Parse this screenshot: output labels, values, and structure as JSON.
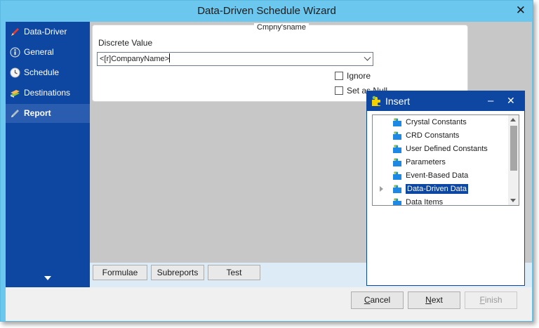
{
  "window": {
    "title": "Data-Driven Schedule Wizard"
  },
  "sidebar": {
    "items": [
      {
        "label": "Data-Driver",
        "icon": "pen-icon",
        "active": false
      },
      {
        "label": "General",
        "icon": "info-icon",
        "active": false
      },
      {
        "label": "Schedule",
        "icon": "clock-icon",
        "active": false
      },
      {
        "label": "Destinations",
        "icon": "books-icon",
        "active": false
      },
      {
        "label": "Report",
        "icon": "pencil-icon",
        "active": true
      }
    ]
  },
  "parameter": {
    "group_title": "Cmpny'sname",
    "field_label": "Discrete Value",
    "value": "<[r]CompanyName>",
    "ignore_label": "Ignore",
    "ignore_checked": false,
    "null_label": "Set as Null",
    "null_checked": false
  },
  "toolbar": {
    "formulae_label": "Formulae",
    "subreports_label": "Subreports",
    "test_label": "Test"
  },
  "footer": {
    "cancel_label": "Cancel",
    "next_label": "Next",
    "finish_label": "Finish",
    "finish_enabled": false
  },
  "insert_panel": {
    "title": "Insert",
    "minimize_glyph": "–",
    "close_glyph": "✕",
    "items": [
      {
        "label": "Crystal Constants",
        "selected": false
      },
      {
        "label": "CRD Constants",
        "selected": false
      },
      {
        "label": "User Defined Constants",
        "selected": false
      },
      {
        "label": "Parameters",
        "selected": false
      },
      {
        "label": "Event-Based Data",
        "selected": false
      },
      {
        "label": "Data-Driven Data",
        "selected": true
      },
      {
        "label": "Data Items",
        "selected": false
      }
    ]
  },
  "colors": {
    "title_bar": "#6cc7ee",
    "sidebar": "#0d47a1",
    "selection": "#0d47a1",
    "content_bg": "#c7c7c7"
  }
}
